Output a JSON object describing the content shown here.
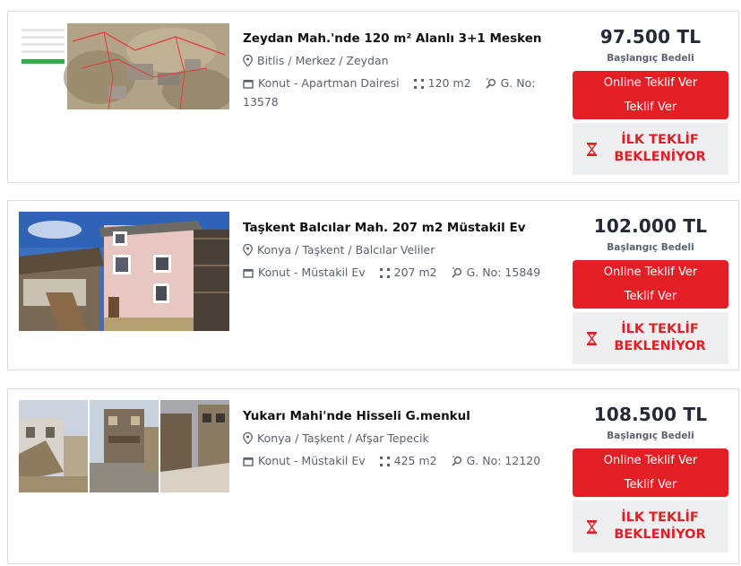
{
  "listings": [
    {
      "title": "Zeydan Mah.'nde 120 m² Alanlı 3+1 Mesken",
      "location": "Bitlis / Merkez / Zeydan",
      "type": "Konut - Apartman Dairesi",
      "area": "120 m2",
      "gno": "G. No:",
      "gno_value": "13578",
      "price": "97.500 TL",
      "price_label": "Başlangıç Bedeli",
      "online_bid": "Online Teklif Ver",
      "bid": "Teklif Ver",
      "status": "İLK TEKLİF BEKLENİYOR"
    },
    {
      "title": "Taşkent Balcılar Mah. 207 m2 Müstakil Ev",
      "location": "Konya / Taşkent / Balcılar Veliler",
      "type": "Konut - Müstakil Ev",
      "area": "207 m2",
      "gno": "G. No: 15849",
      "price": "102.000 TL",
      "price_label": "Başlangıç Bedeli",
      "online_bid": "Online Teklif Ver",
      "bid": "Teklif Ver",
      "status": "İLK TEKLİF BEKLENİYOR"
    },
    {
      "title": "Yukarı Mahi'nde Hisseli G.menkul",
      "location": "Konya / Taşkent / Afşar Tepecik",
      "type": "Konut - Müstakil Ev",
      "area": "425 m2",
      "gno": "G. No: 12120",
      "price": "108.500 TL",
      "price_label": "Başlangıç Bedeli",
      "online_bid": "Online Teklif Ver",
      "bid": "Teklif Ver",
      "status": "İLK TEKLİF BEKLENİYOR"
    }
  ],
  "icons": {
    "location": "map-pin-icon",
    "type": "building-icon",
    "area": "area-dots-icon",
    "gno": "parcel-search-icon",
    "status": "hourglass-icon"
  },
  "colors": {
    "accent": "#e31e24",
    "waiting_bg": "#eeeff1",
    "price_text": "#222a36"
  }
}
